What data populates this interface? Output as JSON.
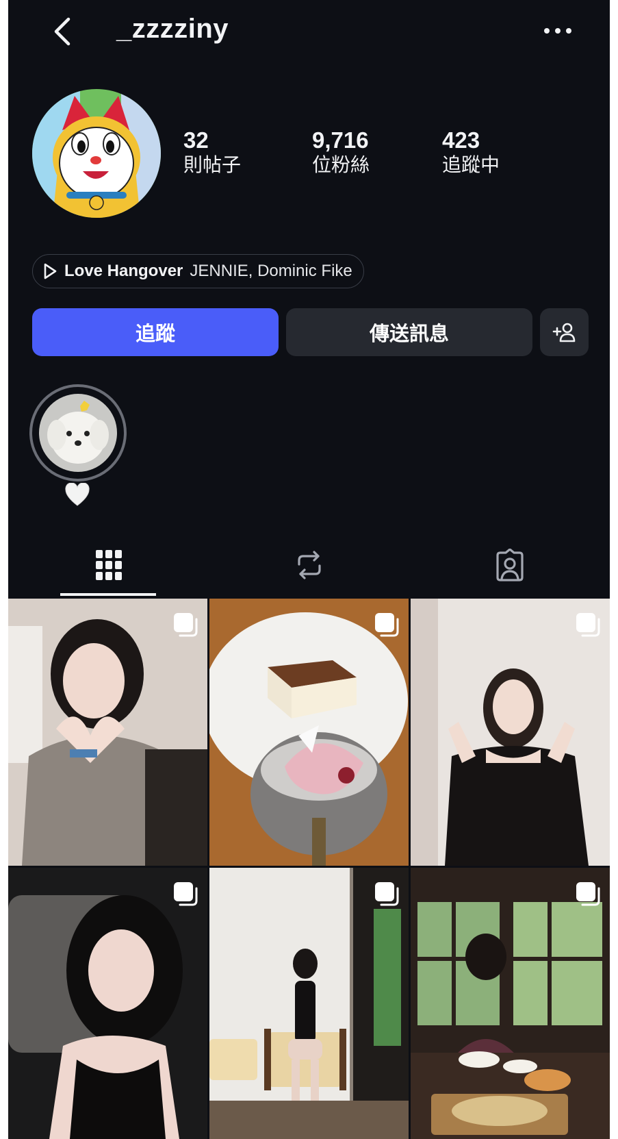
{
  "header": {
    "username": "_zzzziny"
  },
  "stats": [
    {
      "value": "32",
      "label": "則帖子"
    },
    {
      "value": "9,716",
      "label": "位粉絲"
    },
    {
      "value": "423",
      "label": "追蹤中"
    }
  ],
  "music": {
    "title": "Love Hangover",
    "artist": "JENNIE, Dominic Fike"
  },
  "actions": {
    "follow": "追蹤",
    "message": "傳送訊息"
  },
  "highlights": [
    {
      "label": "🤍"
    }
  ],
  "tabs": [
    "grid-icon",
    "reposts-icon",
    "tagged-icon"
  ],
  "colors": {
    "background": "#0d0f15",
    "accent": "#4a5df9",
    "button": "#262930"
  }
}
